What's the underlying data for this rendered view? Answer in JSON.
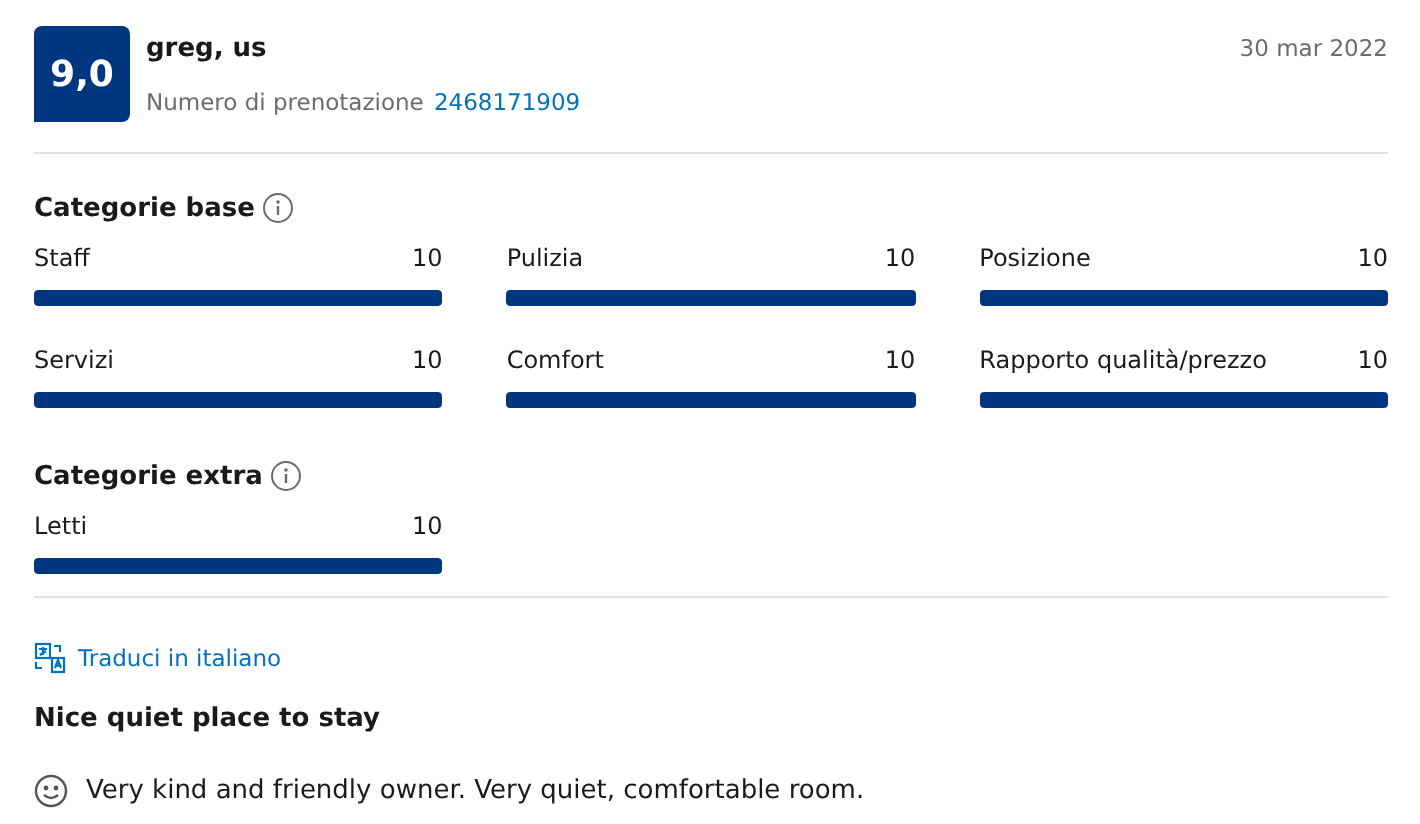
{
  "review": {
    "score": "9,0",
    "reviewer": "greg, us",
    "booking_label": "Numero di prenotazione",
    "booking_number": "2468171909",
    "date": "30 mar 2022"
  },
  "sections": [
    {
      "title": "Categorie base",
      "categories": [
        {
          "name": "Staff",
          "score": "10",
          "level": 1
        },
        {
          "name": "Pulizia",
          "score": "10",
          "level": 1
        },
        {
          "name": "Posizione",
          "score": "10",
          "level": 1
        },
        {
          "name": "Servizi",
          "score": "10",
          "level": 1
        },
        {
          "name": "Comfort",
          "score": "10",
          "level": 1
        },
        {
          "name": "Rapporto qualità/prezzo",
          "score": "10",
          "level": 1
        }
      ]
    },
    {
      "title": "Categorie extra",
      "categories": [
        {
          "name": "Letti",
          "score": "10",
          "level": 1
        }
      ]
    }
  ],
  "translate_link": "Traduci in italiano",
  "review_title": "Nice quiet place to stay",
  "positive_text": "Very kind and friendly owner. Very quiet, comfortable room."
}
